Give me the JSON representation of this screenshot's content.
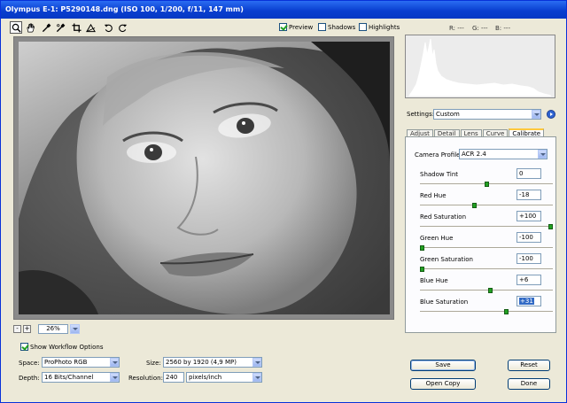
{
  "window": {
    "title": "Olympus E-1:  P5290148.dng  (ISO 100, 1/200, f/11, 147 mm)"
  },
  "toolbar": {
    "tools": [
      {
        "name": "zoom-tool-icon"
      },
      {
        "name": "hand-tool-icon"
      },
      {
        "name": "white-balance-tool-icon"
      },
      {
        "name": "color-sampler-tool-icon"
      },
      {
        "name": "crop-tool-icon"
      },
      {
        "name": "straighten-tool-icon"
      },
      {
        "name": "rotate-left-icon"
      },
      {
        "name": "rotate-right-icon"
      }
    ],
    "preview_label": "Preview",
    "preview_checked": true,
    "shadows_label": "Shadows",
    "shadows_checked": false,
    "highlights_label": "Highlights",
    "highlights_checked": false
  },
  "readout": {
    "r": "R: ---",
    "g": "G: ---",
    "b": "B: ---"
  },
  "zoom": {
    "minus": "-",
    "plus": "+",
    "value": "26%"
  },
  "workflow": {
    "show_options_label": "Show Workflow Options",
    "show_options_checked": true,
    "space_label": "Space:",
    "space_value": "ProPhoto RGB",
    "depth_label": "Depth:",
    "depth_value": "16 Bits/Channel",
    "size_label": "Size:",
    "size_value": "2560 by 1920  (4,9 MP)",
    "resolution_label": "Resolution:",
    "resolution_value": "240",
    "resolution_unit": "pixels/inch"
  },
  "settings": {
    "label": "Settings:",
    "value": "Custom"
  },
  "tabs": [
    "Adjust",
    "Detail",
    "Lens",
    "Curve",
    "Calibrate"
  ],
  "active_tab": "Calibrate",
  "calibrate": {
    "camera_profile_label": "Camera Profile:",
    "camera_profile_value": "ACR 2.4",
    "sliders": [
      {
        "label": "Shadow Tint",
        "value": "0",
        "position": 0.5
      },
      {
        "label": "Red Hue",
        "value": "-18",
        "position": 0.41
      },
      {
        "label": "Red Saturation",
        "value": "+100",
        "position": 1.0
      },
      {
        "label": "Green Hue",
        "value": "-100",
        "position": 0.0
      },
      {
        "label": "Green Saturation",
        "value": "-100",
        "position": 0.0
      },
      {
        "label": "Blue Hue",
        "value": "+6",
        "position": 0.53
      },
      {
        "label": "Blue Saturation",
        "value": "+31",
        "position": 0.655
      }
    ]
  },
  "buttons": {
    "save": "Save",
    "reset": "Reset",
    "open_copy": "Open Copy",
    "done": "Done"
  },
  "colors": {
    "title_bar": "#0a3fd0",
    "check_green": "#21a121",
    "selection": "#316ac5"
  }
}
